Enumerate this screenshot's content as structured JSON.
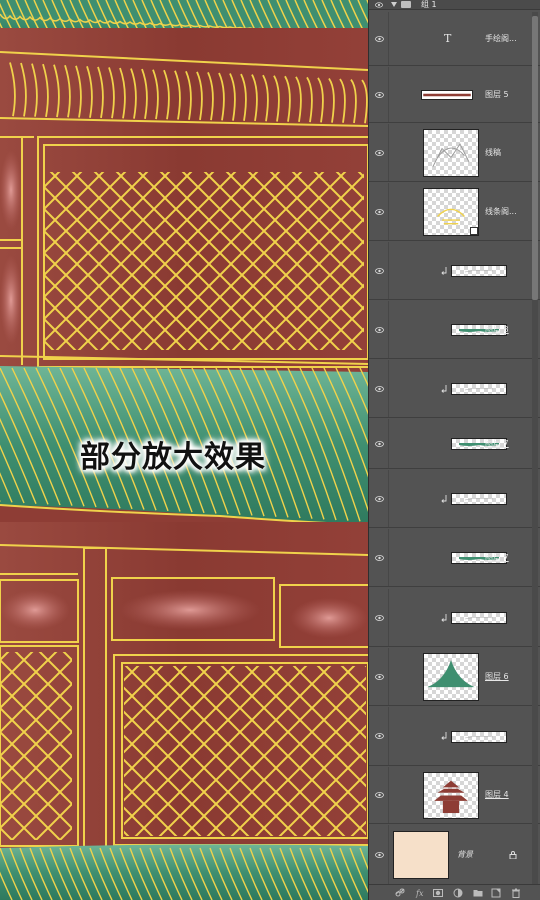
{
  "canvas": {
    "caption": "部分放大效果",
    "colors": {
      "wall": "#8e3d35",
      "gold": "#f0d24b",
      "roof_green": "#3f8f70",
      "beam": "#7e342d"
    }
  },
  "layers_panel": {
    "group": {
      "name": "组 1",
      "icon": "folder-icon"
    },
    "layers": [
      {
        "kind": "text",
        "name": "手绘阁..."
      },
      {
        "kind": "shape",
        "name": "图层 5"
      },
      {
        "kind": "sketch",
        "name": "线稿"
      },
      {
        "kind": "smart",
        "name": "线条阁..."
      },
      {
        "kind": "clip",
        "name": ""
      },
      {
        "kind": "roof",
        "name": "图层 8"
      },
      {
        "kind": "clip",
        "name": ""
      },
      {
        "kind": "roof",
        "name": "图层 7"
      },
      {
        "kind": "clip",
        "name": ""
      },
      {
        "kind": "roof",
        "name": "图层 7"
      },
      {
        "kind": "clip",
        "name": ""
      },
      {
        "kind": "roof-peak",
        "name": "图层 6"
      },
      {
        "kind": "clip",
        "name": ""
      },
      {
        "kind": "pagoda",
        "name": "图层 4"
      },
      {
        "kind": "background",
        "name": "背景"
      }
    ],
    "background_swatch": "#f6e0c9",
    "toolbar_icons": [
      "link-icon",
      "fx-icon",
      "mask-icon",
      "adjustment-icon",
      "new-group-icon",
      "new-layer-icon",
      "trash-icon"
    ]
  }
}
